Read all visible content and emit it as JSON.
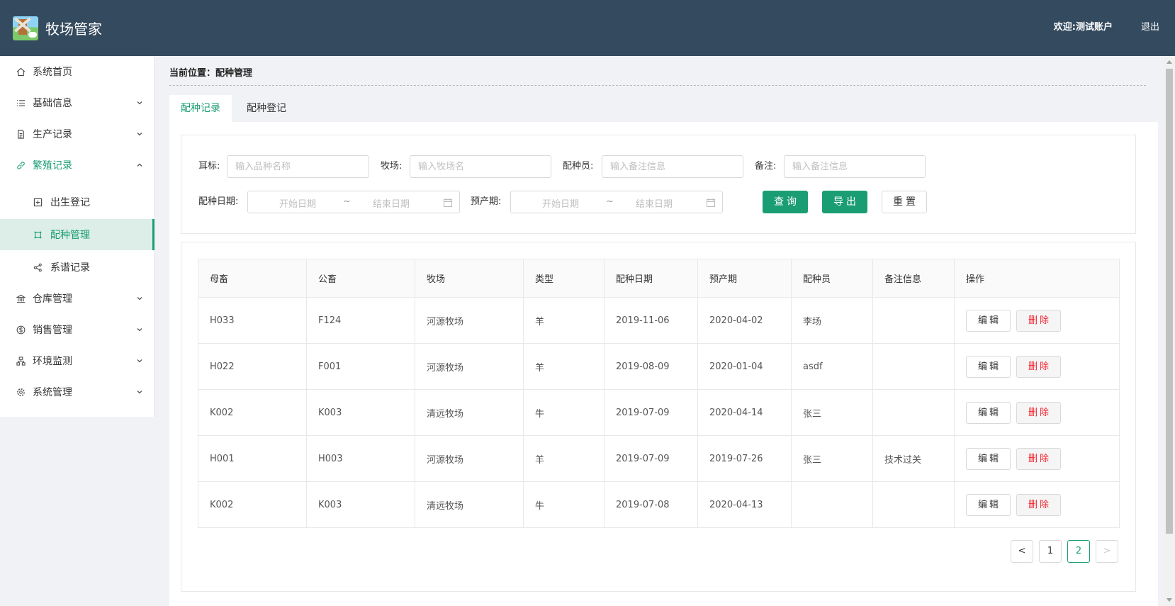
{
  "header": {
    "title": "牧场管家",
    "welcome": "欢迎:测试账户",
    "logout": "退出"
  },
  "sidebar": {
    "items": [
      {
        "label": "系统首页",
        "icon": "home-icon"
      },
      {
        "label": "基础信息",
        "icon": "list-icon"
      },
      {
        "label": "生产记录",
        "icon": "document-icon"
      },
      {
        "label": "繁殖记录",
        "icon": "link-icon"
      },
      {
        "label": "出生登记",
        "icon": "plus-square-icon"
      },
      {
        "label": "配种管理",
        "icon": "crop-icon"
      },
      {
        "label": "系谱记录",
        "icon": "share-icon"
      },
      {
        "label": "仓库管理",
        "icon": "bank-icon"
      },
      {
        "label": "销售管理",
        "icon": "money-icon"
      },
      {
        "label": "环境监测",
        "icon": "cluster-icon"
      },
      {
        "label": "系统管理",
        "icon": "gear-icon"
      }
    ]
  },
  "breadcrumb": "当前位置：配种管理",
  "tabs": [
    {
      "label": "配种记录"
    },
    {
      "label": "配种登记"
    }
  ],
  "search": {
    "ear_tag_label": "耳标:",
    "ear_tag_placeholder": "输入品种名称",
    "farm_label": "牧场:",
    "farm_placeholder": "输入牧场名",
    "breeder_label": "配种员:",
    "breeder_placeholder": "输入备注信息",
    "note_label": "备注:",
    "note_placeholder": "输入备注信息",
    "breed_date_label": "配种日期:",
    "due_date_label": "预产期:",
    "start_placeholder": "开始日期",
    "end_placeholder": "结束日期",
    "range_sep": "~",
    "query_button": "查询",
    "export_button": "导出",
    "reset_button": "重置"
  },
  "table": {
    "columns": [
      "母畜",
      "公畜",
      "牧场",
      "类型",
      "配种日期",
      "预产期",
      "配种员",
      "备注信息",
      "操作"
    ],
    "edit_label": "编辑",
    "delete_label": "删除",
    "rows": [
      [
        "H033",
        "F124",
        "河源牧场",
        "羊",
        "2019-11-06",
        "2020-04-02",
        "李场",
        ""
      ],
      [
        "H022",
        "F001",
        "河源牧场",
        "羊",
        "2019-08-09",
        "2020-01-04",
        "asdf",
        ""
      ],
      [
        "K002",
        "K003",
        "清远牧场",
        "牛",
        "2019-07-09",
        "2020-04-14",
        "张三",
        ""
      ],
      [
        "H001",
        "H003",
        "河源牧场",
        "羊",
        "2019-07-09",
        "2019-07-26",
        "张三",
        "技术过关"
      ],
      [
        "K002",
        "K003",
        "清远牧场",
        "牛",
        "2019-07-08",
        "2020-04-13",
        "",
        ""
      ]
    ]
  },
  "pagination": {
    "prev": "<",
    "pages": [
      "1",
      "2"
    ],
    "current": "2",
    "next": ">"
  },
  "colors": {
    "header_bg": "#344a5f",
    "accent": "#1b9d74",
    "danger": "#f5222d"
  }
}
